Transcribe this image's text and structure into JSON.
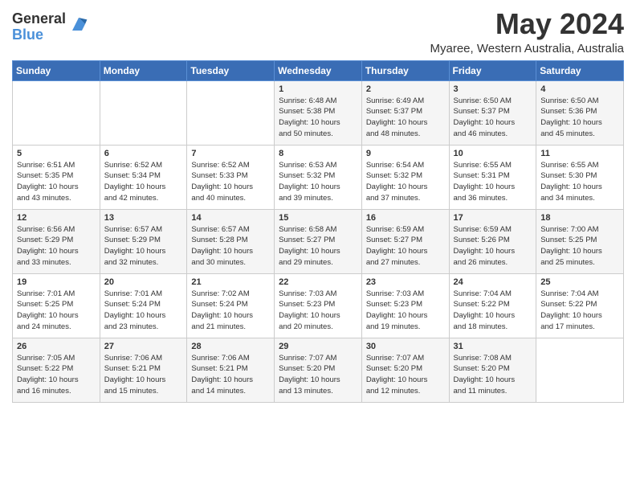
{
  "header": {
    "logo_general": "General",
    "logo_blue": "Blue",
    "title": "May 2024",
    "subtitle": "Myaree, Western Australia, Australia"
  },
  "days_of_week": [
    "Sunday",
    "Monday",
    "Tuesday",
    "Wednesday",
    "Thursday",
    "Friday",
    "Saturday"
  ],
  "weeks": [
    [
      {
        "day": "",
        "info": ""
      },
      {
        "day": "",
        "info": ""
      },
      {
        "day": "",
        "info": ""
      },
      {
        "day": "1",
        "info": "Sunrise: 6:48 AM\nSunset: 5:38 PM\nDaylight: 10 hours\nand 50 minutes."
      },
      {
        "day": "2",
        "info": "Sunrise: 6:49 AM\nSunset: 5:37 PM\nDaylight: 10 hours\nand 48 minutes."
      },
      {
        "day": "3",
        "info": "Sunrise: 6:50 AM\nSunset: 5:37 PM\nDaylight: 10 hours\nand 46 minutes."
      },
      {
        "day": "4",
        "info": "Sunrise: 6:50 AM\nSunset: 5:36 PM\nDaylight: 10 hours\nand 45 minutes."
      }
    ],
    [
      {
        "day": "5",
        "info": "Sunrise: 6:51 AM\nSunset: 5:35 PM\nDaylight: 10 hours\nand 43 minutes."
      },
      {
        "day": "6",
        "info": "Sunrise: 6:52 AM\nSunset: 5:34 PM\nDaylight: 10 hours\nand 42 minutes."
      },
      {
        "day": "7",
        "info": "Sunrise: 6:52 AM\nSunset: 5:33 PM\nDaylight: 10 hours\nand 40 minutes."
      },
      {
        "day": "8",
        "info": "Sunrise: 6:53 AM\nSunset: 5:32 PM\nDaylight: 10 hours\nand 39 minutes."
      },
      {
        "day": "9",
        "info": "Sunrise: 6:54 AM\nSunset: 5:32 PM\nDaylight: 10 hours\nand 37 minutes."
      },
      {
        "day": "10",
        "info": "Sunrise: 6:55 AM\nSunset: 5:31 PM\nDaylight: 10 hours\nand 36 minutes."
      },
      {
        "day": "11",
        "info": "Sunrise: 6:55 AM\nSunset: 5:30 PM\nDaylight: 10 hours\nand 34 minutes."
      }
    ],
    [
      {
        "day": "12",
        "info": "Sunrise: 6:56 AM\nSunset: 5:29 PM\nDaylight: 10 hours\nand 33 minutes."
      },
      {
        "day": "13",
        "info": "Sunrise: 6:57 AM\nSunset: 5:29 PM\nDaylight: 10 hours\nand 32 minutes."
      },
      {
        "day": "14",
        "info": "Sunrise: 6:57 AM\nSunset: 5:28 PM\nDaylight: 10 hours\nand 30 minutes."
      },
      {
        "day": "15",
        "info": "Sunrise: 6:58 AM\nSunset: 5:27 PM\nDaylight: 10 hours\nand 29 minutes."
      },
      {
        "day": "16",
        "info": "Sunrise: 6:59 AM\nSunset: 5:27 PM\nDaylight: 10 hours\nand 27 minutes."
      },
      {
        "day": "17",
        "info": "Sunrise: 6:59 AM\nSunset: 5:26 PM\nDaylight: 10 hours\nand 26 minutes."
      },
      {
        "day": "18",
        "info": "Sunrise: 7:00 AM\nSunset: 5:25 PM\nDaylight: 10 hours\nand 25 minutes."
      }
    ],
    [
      {
        "day": "19",
        "info": "Sunrise: 7:01 AM\nSunset: 5:25 PM\nDaylight: 10 hours\nand 24 minutes."
      },
      {
        "day": "20",
        "info": "Sunrise: 7:01 AM\nSunset: 5:24 PM\nDaylight: 10 hours\nand 23 minutes."
      },
      {
        "day": "21",
        "info": "Sunrise: 7:02 AM\nSunset: 5:24 PM\nDaylight: 10 hours\nand 21 minutes."
      },
      {
        "day": "22",
        "info": "Sunrise: 7:03 AM\nSunset: 5:23 PM\nDaylight: 10 hours\nand 20 minutes."
      },
      {
        "day": "23",
        "info": "Sunrise: 7:03 AM\nSunset: 5:23 PM\nDaylight: 10 hours\nand 19 minutes."
      },
      {
        "day": "24",
        "info": "Sunrise: 7:04 AM\nSunset: 5:22 PM\nDaylight: 10 hours\nand 18 minutes."
      },
      {
        "day": "25",
        "info": "Sunrise: 7:04 AM\nSunset: 5:22 PM\nDaylight: 10 hours\nand 17 minutes."
      }
    ],
    [
      {
        "day": "26",
        "info": "Sunrise: 7:05 AM\nSunset: 5:22 PM\nDaylight: 10 hours\nand 16 minutes."
      },
      {
        "day": "27",
        "info": "Sunrise: 7:06 AM\nSunset: 5:21 PM\nDaylight: 10 hours\nand 15 minutes."
      },
      {
        "day": "28",
        "info": "Sunrise: 7:06 AM\nSunset: 5:21 PM\nDaylight: 10 hours\nand 14 minutes."
      },
      {
        "day": "29",
        "info": "Sunrise: 7:07 AM\nSunset: 5:20 PM\nDaylight: 10 hours\nand 13 minutes."
      },
      {
        "day": "30",
        "info": "Sunrise: 7:07 AM\nSunset: 5:20 PM\nDaylight: 10 hours\nand 12 minutes."
      },
      {
        "day": "31",
        "info": "Sunrise: 7:08 AM\nSunset: 5:20 PM\nDaylight: 10 hours\nand 11 minutes."
      },
      {
        "day": "",
        "info": ""
      }
    ]
  ]
}
